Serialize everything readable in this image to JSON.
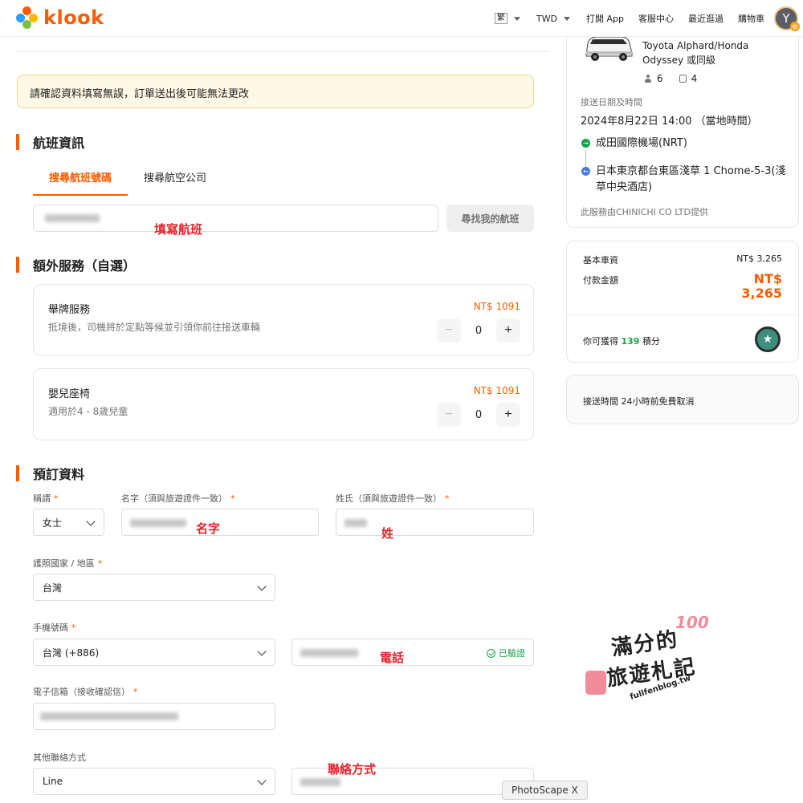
{
  "header": {
    "logo_text": "klook",
    "lang": "繁",
    "currency": "TWD",
    "open_app": "打開 App",
    "support": "客服中心",
    "recent": "最近逛過",
    "cart": "購物車",
    "avatar_initial": "Y"
  },
  "alert": "請確認資料填寫無誤，訂單送出後可能無法更改",
  "flight": {
    "title": "航班資訊",
    "tabs": [
      "搜尋航班號碼",
      "搜尋航空公司"
    ],
    "find_button": "尋找我的航班",
    "annotation": "填寫航班"
  },
  "extras": {
    "title": "額外服務（自選）",
    "items": [
      {
        "name": "舉牌服務",
        "desc": "抵境後，司機將於定點等候並引領你前往接送車輛",
        "price": "NT$ 1091",
        "qty": "0"
      },
      {
        "name": "嬰兒座椅",
        "desc": "適用於4 - 8歲兒童",
        "price": "NT$ 1091",
        "qty": "0"
      }
    ]
  },
  "booking": {
    "title": "預訂資料",
    "salutation_label": "稱謂",
    "salutation_value": "女士",
    "first_name_label": "名字（須與旅遊證件一致）",
    "last_name_label": "姓氏（須與旅遊證件一致）",
    "first_name_anno": "名字",
    "last_name_anno": "姓",
    "passport_label": "護照國家 / 地區",
    "passport_value": "台灣",
    "phone_label": "手機號碼",
    "phone_code": "台灣 (+886)",
    "verified": "已驗證",
    "phone_anno": "電話",
    "email_label": "電子信箱（接收確認信）",
    "other_contact_label": "其他聯絡方式",
    "other_contact_value": "Line",
    "other_contact_anno": "聯絡方式",
    "required_mark": "*"
  },
  "summary": {
    "car_name": "Toyota Alphard/Honda Odyssey 或同級",
    "passengers": "6",
    "luggage": "4",
    "date_label": "接送日期及時間",
    "date_value": "2024年8月22日 14:00 （當地時間）",
    "from": "成田國際機場(NRT)",
    "to": "日本東京都台東區淺草 1 Chome-5-3(淺草中央酒店)",
    "provider": "此服務由CHINICHI CO LTD提供"
  },
  "price": {
    "base_label": "基本車資",
    "base_value": "NT$ 3,265",
    "pay_label": "付款金額",
    "pay_currency": "NT$",
    "pay_value": "3,265",
    "points_prefix": "你可獲得",
    "points_value": "139",
    "points_suffix": "積分"
  },
  "cancel_policy": "接送時間 24小時前免費取消",
  "watermark": {
    "line1": "滿分的",
    "line2": "旅遊札記",
    "url": "fullfenblog.tw",
    "badge": "100"
  },
  "tooltip": "PhotoScape X",
  "colors": {
    "accent": "#ff5b00",
    "verified": "#16a34a",
    "annotation": "#e3242b"
  }
}
